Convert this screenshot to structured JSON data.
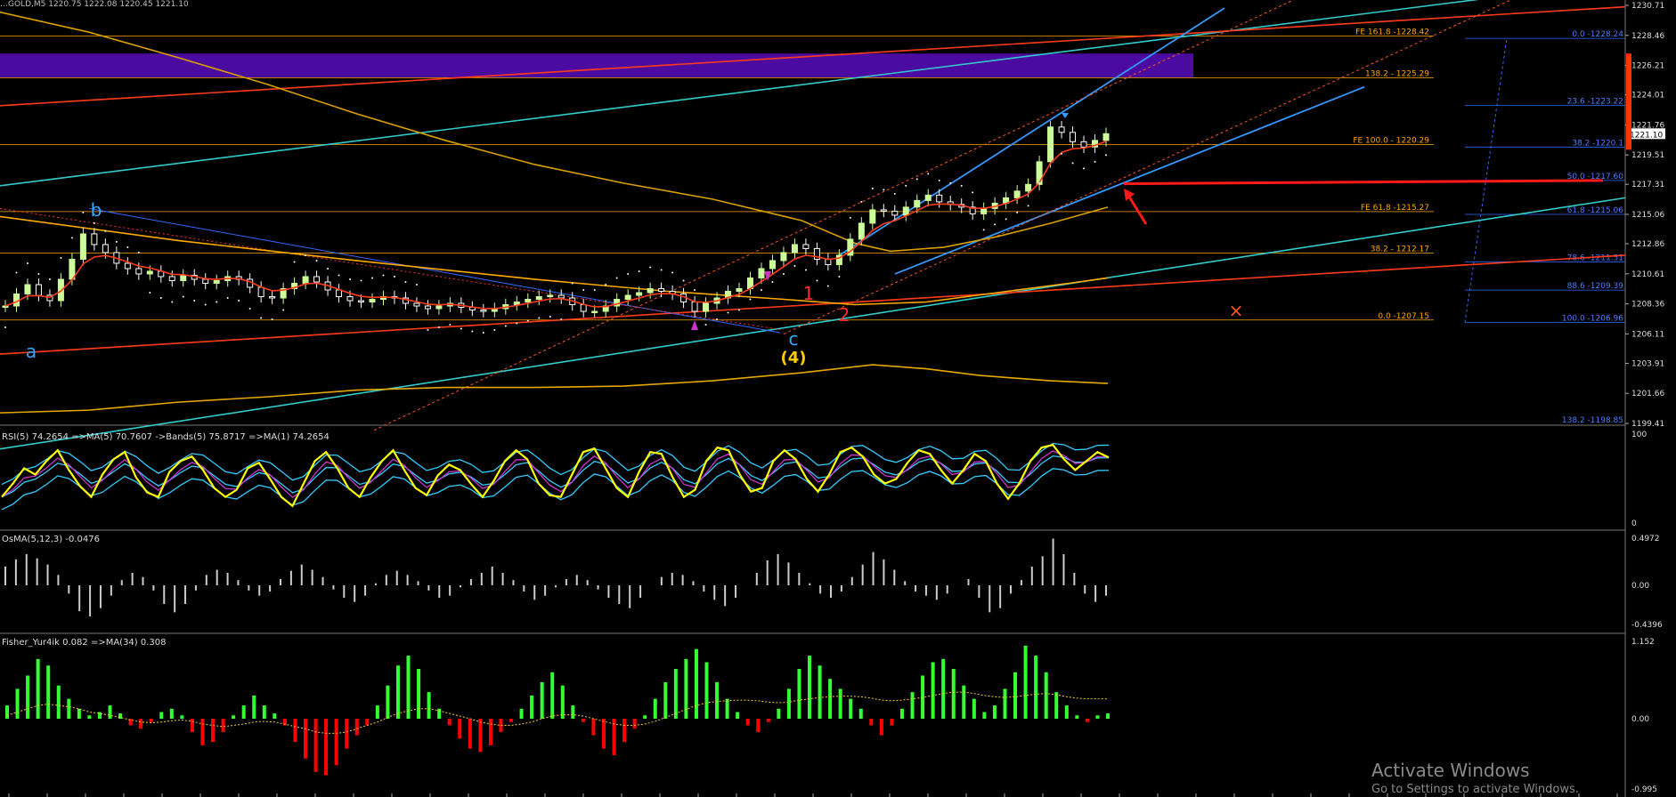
{
  "window": {
    "title_fragment": "…GOLD,M5 1220.75 1222.08 1220.45 1221.10"
  },
  "colors": {
    "background": "#000000",
    "up_candle": "#ccff99",
    "down_candle": "#ffffff",
    "fib_orange": "#ffa500",
    "fib_blue": "#3366ff",
    "trend_red": "#ff3b1a",
    "trend_cyan": "#33cccc",
    "trend_blue": "#3399ff",
    "zone_purple": "#4b0aa0",
    "rsi_yellow": "#ffff00",
    "rsi_band": "#33ccff",
    "rsi_ma": "#cc33cc",
    "osma_gray": "#cccccc",
    "fisher_green": "#33ff33",
    "fisher_red": "#ff0000",
    "fisher_ma": "#ffcc33"
  },
  "chart_data": [
    {
      "type": "candlestick",
      "title": "",
      "ylim": [
        1199.41,
        1230.71
      ],
      "price_ticks": [
        "1230.71",
        "1228.46",
        "1226.21",
        "1224.01",
        "1221.76",
        "1219.51",
        "1217.31",
        "1215.06",
        "1212.86",
        "1210.61",
        "1208.36",
        "1206.11",
        "1203.91",
        "1201.66",
        "1199.41"
      ],
      "current_price": "1221.10",
      "close_series": [
        1208.2,
        1209.1,
        1209.8,
        1209.0,
        1208.6,
        1210.2,
        1211.7,
        1213.6,
        1212.8,
        1212.2,
        1211.4,
        1211.0,
        1210.6,
        1210.8,
        1210.4,
        1210.1,
        1210.5,
        1210.2,
        1209.9,
        1210.1,
        1210.4,
        1210.2,
        1209.6,
        1208.9,
        1208.8,
        1209.5,
        1209.9,
        1210.4,
        1210.0,
        1209.4,
        1208.9,
        1208.6,
        1208.5,
        1208.7,
        1208.9,
        1208.8,
        1208.4,
        1208.2,
        1208.0,
        1208.2,
        1208.4,
        1208.1,
        1207.9,
        1207.8,
        1208.0,
        1208.3,
        1208.5,
        1208.7,
        1208.9,
        1209.0,
        1208.8,
        1208.3,
        1207.8,
        1207.8,
        1208.2,
        1208.7,
        1209.0,
        1209.2,
        1209.5,
        1209.3,
        1209.1,
        1208.5,
        1207.8,
        1208.4,
        1208.8,
        1209.3,
        1209.5,
        1210.3,
        1211.0,
        1211.6,
        1212.2,
        1212.8,
        1212.5,
        1211.7,
        1211.3,
        1212.0,
        1213.2,
        1214.4,
        1215.4,
        1215.3,
        1215.0,
        1215.6,
        1216.1,
        1216.5,
        1216.0,
        1215.8,
        1215.6,
        1215.1,
        1215.5,
        1215.9,
        1216.3,
        1216.8,
        1217.3,
        1219.0,
        1221.6,
        1221.2,
        1220.5,
        1220.1,
        1220.6,
        1221.1
      ],
      "fib_levels": [
        {
          "label": "FE 161.8 -1228.42",
          "price": 1228.42
        },
        {
          "label": "138.2 - 1225.29",
          "price": 1225.29
        },
        {
          "label": "FE 100.0 - 1220.29",
          "price": 1220.29
        },
        {
          "label": "FE 61.8 -1215.27",
          "price": 1215.27
        },
        {
          "label": "38.2 - 1212.17",
          "price": 1212.17
        },
        {
          "label": "0.0 -1207.15",
          "price": 1207.15
        }
      ],
      "retracement_levels": [
        {
          "label": "0.0 -1228.24",
          "price": 1228.24
        },
        {
          "label": "23.6 -1223.22",
          "price": 1223.22
        },
        {
          "label": "38.2 -1220.1",
          "price": 1220.1
        },
        {
          "label": "50.0 -1217.60",
          "price": 1217.6
        },
        {
          "label": "61.8 -1215.06",
          "price": 1215.06
        },
        {
          "label": "78.6 -1211.51",
          "price": 1211.51
        },
        {
          "label": "88.6 -1209.39",
          "price": 1209.39
        },
        {
          "label": "100.0 -1206.96",
          "price": 1206.96
        },
        {
          "label": "138.2 -1198.85",
          "price": 1198.85
        }
      ],
      "wave_labels": [
        {
          "text": "a",
          "color": "#33aaff"
        },
        {
          "text": "b",
          "color": "#33aaff"
        },
        {
          "text": "c",
          "color": "#33aaff"
        },
        {
          "text": "(4)",
          "color": "#ffcc00"
        },
        {
          "text": "1",
          "color": "#ff2a2a"
        },
        {
          "text": "2",
          "color": "#ff2a2a"
        },
        {
          "text": "×",
          "color": "#ff5522"
        }
      ]
    },
    {
      "type": "line",
      "title": "RSI(5) 74.2654 =>MA(5) 70.7607 ->Bands(5) 75.8717 =>MA(1) 74.2654",
      "ylim": [
        0,
        100
      ],
      "ticks": [
        "100",
        "0"
      ],
      "values": [
        30,
        45,
        62,
        55,
        70,
        82,
        60,
        42,
        30,
        55,
        72,
        80,
        52,
        35,
        30,
        58,
        70,
        75,
        60,
        40,
        30,
        38,
        62,
        68,
        50,
        30,
        20,
        45,
        70,
        80,
        62,
        40,
        30,
        52,
        70,
        82,
        60,
        40,
        32,
        54,
        66,
        60,
        44,
        30,
        48,
        70,
        82,
        72,
        45,
        32,
        30,
        55,
        80,
        84,
        62,
        40,
        30,
        58,
        80,
        78,
        52,
        30,
        38,
        70,
        85,
        82,
        55,
        36,
        40,
        70,
        82,
        72,
        50,
        36,
        55,
        80,
        85,
        75,
        55,
        45,
        50,
        68,
        82,
        78,
        60,
        45,
        60,
        78,
        70,
        45,
        28,
        45,
        70,
        85,
        88,
        72,
        60,
        70,
        80,
        74
      ]
    },
    {
      "type": "bar",
      "title": "OsMA(5,12,3) -0.0476",
      "ylim": [
        -0.4396,
        0.4972
      ],
      "ticks": [
        "0.4972",
        "0.00",
        "-0.4396"
      ],
      "values": [
        0.18,
        0.25,
        0.3,
        0.26,
        0.2,
        0.1,
        -0.08,
        -0.25,
        -0.3,
        -0.22,
        -0.1,
        0.05,
        0.12,
        0.08,
        -0.05,
        -0.18,
        -0.26,
        -0.18,
        -0.05,
        0.1,
        0.15,
        0.12,
        0.05,
        -0.05,
        -0.1,
        -0.06,
        0.06,
        0.14,
        0.2,
        0.15,
        0.08,
        -0.04,
        -0.12,
        -0.16,
        -0.1,
        0.02,
        0.1,
        0.14,
        0.1,
        0.04,
        -0.05,
        -0.12,
        -0.1,
        -0.02,
        0.06,
        0.12,
        0.18,
        0.12,
        0.05,
        -0.06,
        -0.14,
        -0.1,
        -0.02,
        0.06,
        0.1,
        0.05,
        -0.04,
        -0.12,
        -0.18,
        -0.22,
        -0.12,
        0.0,
        0.08,
        0.12,
        0.1,
        0.04,
        -0.06,
        -0.14,
        -0.2,
        -0.12,
        0.0,
        0.12,
        0.24,
        0.3,
        0.22,
        0.12,
        0.02,
        -0.08,
        -0.12,
        -0.06,
        0.08,
        0.2,
        0.32,
        0.25,
        0.15,
        0.04,
        -0.06,
        -0.1,
        -0.14,
        -0.08,
        0.0,
        0.06,
        -0.12,
        -0.26,
        -0.22,
        -0.08,
        0.05,
        0.18,
        0.28,
        0.45,
        0.3,
        0.12,
        -0.08,
        -0.16,
        -0.1
      ]
    },
    {
      "type": "bar",
      "title": "Fisher_Yur4ik 0.082 =>MA(34) 0.308",
      "ylim": [
        -0.995,
        1.152
      ],
      "ticks": [
        "1.152",
        "0.00",
        "-0.995"
      ],
      "values": [
        0.2,
        0.45,
        0.65,
        0.9,
        0.8,
        0.5,
        0.3,
        0.15,
        0.05,
        0.1,
        0.2,
        0.08,
        -0.1,
        -0.15,
        -0.05,
        0.1,
        0.15,
        0.05,
        -0.2,
        -0.4,
        -0.35,
        -0.2,
        0.05,
        0.2,
        0.35,
        0.2,
        0.08,
        -0.1,
        -0.35,
        -0.6,
        -0.8,
        -0.85,
        -0.7,
        -0.45,
        -0.25,
        -0.1,
        0.2,
        0.5,
        0.8,
        0.95,
        0.75,
        0.4,
        0.15,
        -0.1,
        -0.3,
        -0.45,
        -0.5,
        -0.4,
        -0.2,
        -0.05,
        0.15,
        0.35,
        0.55,
        0.7,
        0.5,
        0.2,
        -0.05,
        -0.25,
        -0.45,
        -0.55,
        -0.35,
        -0.15,
        0.05,
        0.3,
        0.55,
        0.75,
        0.9,
        1.05,
        0.85,
        0.55,
        0.3,
        0.1,
        -0.1,
        -0.2,
        -0.05,
        0.15,
        0.45,
        0.75,
        0.95,
        0.8,
        0.6,
        0.45,
        0.3,
        0.15,
        -0.1,
        -0.25,
        -0.1,
        0.15,
        0.4,
        0.65,
        0.85,
        0.9,
        0.75,
        0.5,
        0.3,
        0.1,
        0.2,
        0.45,
        0.7,
        1.1,
        0.95,
        0.7,
        0.4,
        0.2,
        0.05,
        -0.05,
        0.05,
        0.08
      ],
      "ma_values": [
        0.05,
        0.1,
        0.15,
        0.2,
        0.22,
        0.2,
        0.18,
        0.15,
        0.1,
        0.08,
        0.05,
        0.02,
        -0.02,
        -0.05,
        -0.06,
        -0.05,
        -0.03,
        -0.02,
        -0.04,
        -0.08,
        -0.1,
        -0.12,
        -0.1,
        -0.08,
        -0.05,
        -0.04,
        -0.05,
        -0.08,
        -0.12,
        -0.15,
        -0.2,
        -0.22,
        -0.22,
        -0.2,
        -0.15,
        -0.1,
        -0.05,
        0.02,
        0.08,
        0.12,
        0.15,
        0.15,
        0.12,
        0.08,
        0.04,
        0.0,
        -0.05,
        -0.08,
        -0.1,
        -0.1,
        -0.08,
        -0.05,
        0.0,
        0.04,
        0.06,
        0.06,
        0.04,
        0.0,
        -0.04,
        -0.08,
        -0.1,
        -0.1,
        -0.08,
        -0.04,
        0.02,
        0.08,
        0.14,
        0.2,
        0.24,
        0.26,
        0.27,
        0.28,
        0.28,
        0.27,
        0.25,
        0.24,
        0.25,
        0.28,
        0.3,
        0.32,
        0.33,
        0.34,
        0.34,
        0.33,
        0.31,
        0.28,
        0.27,
        0.28,
        0.3,
        0.32,
        0.35,
        0.38,
        0.4,
        0.4,
        0.38,
        0.35,
        0.33,
        0.32,
        0.33,
        0.35,
        0.37,
        0.38,
        0.36,
        0.33,
        0.31,
        0.3,
        0.3,
        0.3
      ]
    }
  ],
  "watermark": {
    "line1": "Activate Windows",
    "line2": "Go to Settings to activate Windows."
  }
}
